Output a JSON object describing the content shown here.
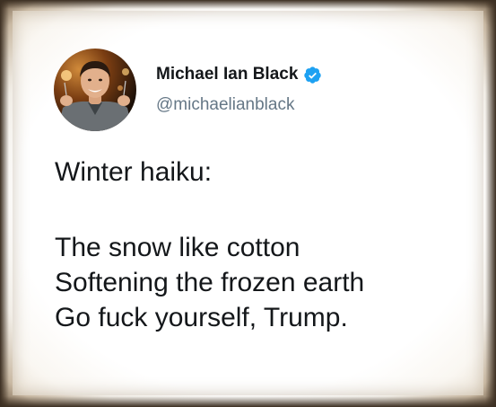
{
  "tweet": {
    "author": {
      "display_name": "Michael Ian Black",
      "handle": "@michaelianblack",
      "verified": true,
      "verified_icon": "verified-badge-icon",
      "verified_color": "#1da1f2"
    },
    "text": {
      "title_line": "Winter haiku:",
      "lines": [
        "The snow like cotton",
        "Softening the frozen earth",
        "Go fuck yourself, Trump."
      ]
    }
  }
}
